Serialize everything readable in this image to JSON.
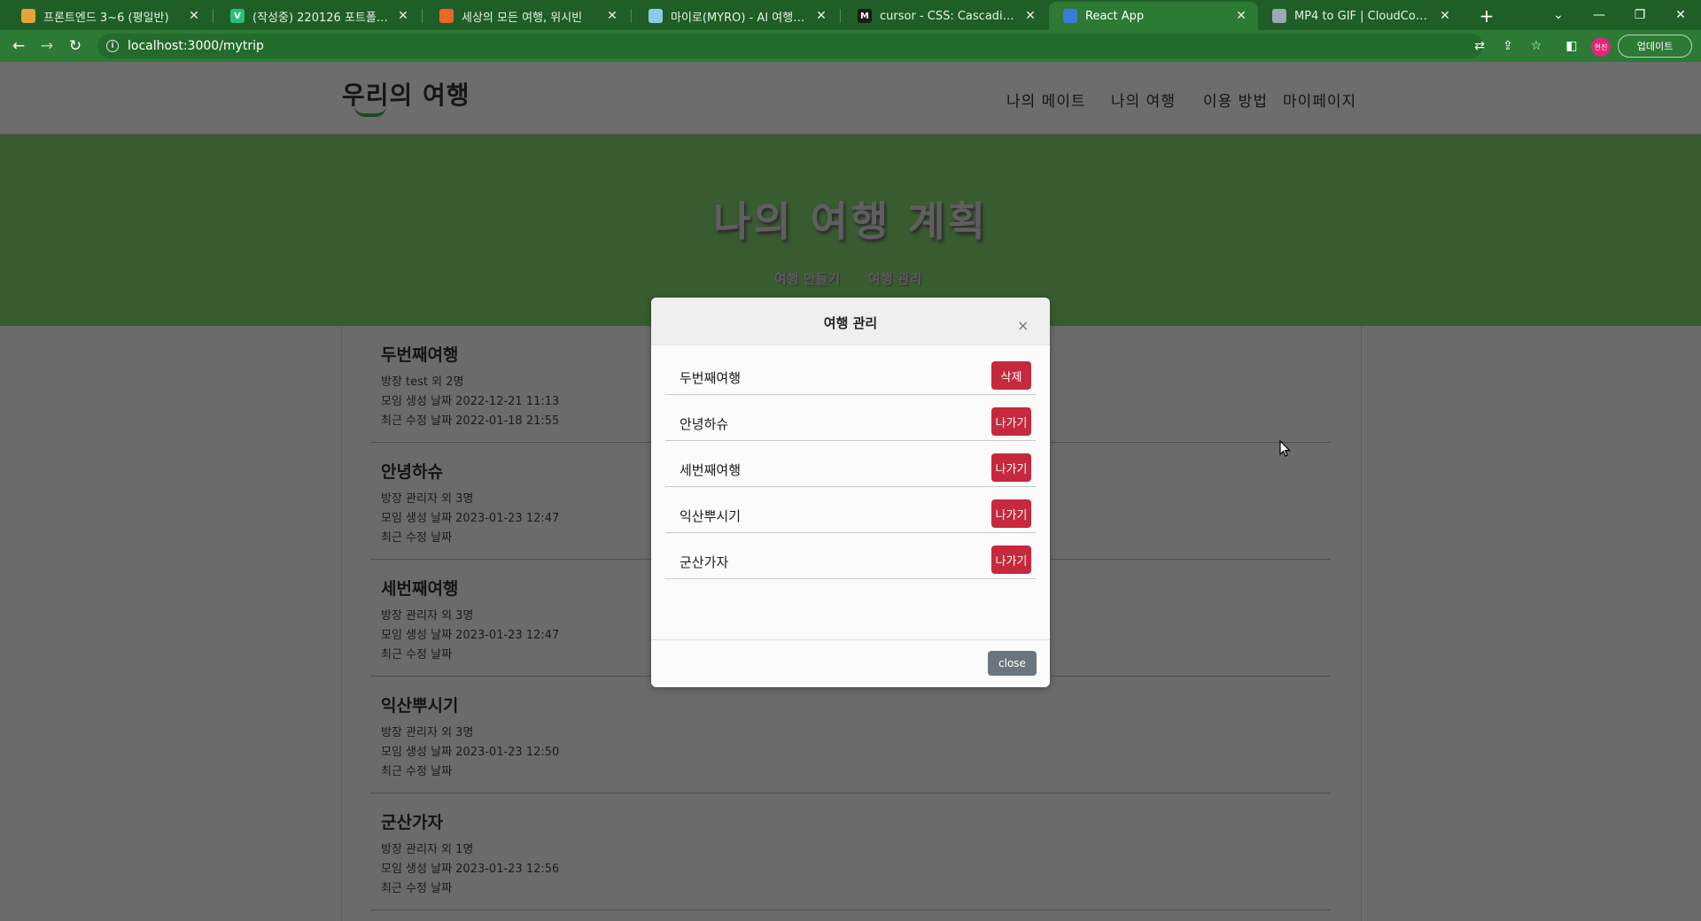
{
  "browser": {
    "tabs": [
      {
        "title": "프론트엔드 3~6 (평일반)",
        "favicon_color": "#e7a23b",
        "favicon_text": "",
        "active": false
      },
      {
        "title": "(작성중) 220126 포트폴리오 프",
        "favicon_color": "#2bbf7a",
        "favicon_text": "V",
        "active": false
      },
      {
        "title": "세상의 모든 여행, 위시빈",
        "favicon_color": "#e8672b",
        "favicon_text": "",
        "active": false
      },
      {
        "title": "마이로(MYRO) - AI 여행 일정 플",
        "favicon_color": "#8ec9e8",
        "favicon_text": "",
        "active": false
      },
      {
        "title": "cursor - CSS: Cascading Style S",
        "favicon_color": "#1b1b1b",
        "favicon_text": "M",
        "active": false
      },
      {
        "title": "React App",
        "favicon_color": "#3a7bd5",
        "favicon_text": "",
        "active": true
      },
      {
        "title": "MP4 to GIF | CloudConvert",
        "favicon_color": "#9ea7b3",
        "favicon_text": "",
        "active": false
      }
    ],
    "url": "localhost:3000/mytrip",
    "profile_initials": "현진",
    "update_label": "업데이트"
  },
  "site": {
    "logo": "우리의 여행",
    "nav": [
      "나의 메이트",
      "나의 여행",
      "이용 방법",
      "마이페이지"
    ],
    "hero_title": "나의 여행 계획",
    "hero_tabs": [
      "여행 만들기",
      "여행 관리"
    ]
  },
  "trips": [
    {
      "name": "두번째여행",
      "host": "방장 test 외 2명",
      "created": "모임 생성 날짜 2022-12-21 11:13",
      "modified": "최근 수정 날짜 2022-01-18 21:55"
    },
    {
      "name": "안녕하슈",
      "host": "방장 관리자 외 3명",
      "created": "모임 생성 날짜 2023-01-23 12:47",
      "modified": "최근 수정 날짜"
    },
    {
      "name": "세번째여행",
      "host": "방장 관리자 외 3명",
      "created": "모임 생성 날짜 2023-01-23 12:47",
      "modified": "최근 수정 날짜"
    },
    {
      "name": "익산뿌시기",
      "host": "방장 관리자 외 3명",
      "created": "모임 생성 날짜 2023-01-23 12:50",
      "modified": "최근 수정 날짜"
    },
    {
      "name": "군산가자",
      "host": "방장 관리자 외 1명",
      "created": "모임 생성 날짜 2023-01-23 12:56",
      "modified": "최근 수정 날짜"
    }
  ],
  "modal": {
    "title": "여행 관리",
    "close_x": "×",
    "rows": [
      {
        "name": "두번째여행",
        "action": "삭제"
      },
      {
        "name": "안녕하슈",
        "action": "나가기"
      },
      {
        "name": "세번째여행",
        "action": "나가기"
      },
      {
        "name": "익산뿌시기",
        "action": "나가기"
      },
      {
        "name": "군산가자",
        "action": "나가기"
      }
    ],
    "close_label": "close"
  },
  "colors": {
    "tab_bar": "#1f5e26",
    "toolbar": "#2c7a34",
    "hero": "#385b30",
    "action_button": "#c6283d",
    "close_button": "#6c757d"
  }
}
